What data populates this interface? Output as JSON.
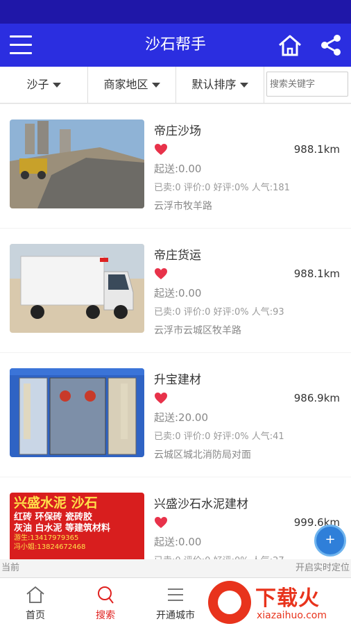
{
  "header": {
    "title": "沙石帮手"
  },
  "filters": {
    "category": "沙子",
    "region": "商家地区",
    "sort": "默认排序",
    "search_placeholder": "搜索关键字"
  },
  "items": [
    {
      "name": "帝庄沙场",
      "distance": "988.1km",
      "delivery": "起送:0.00",
      "stats": "已卖:0 评价:0 好评:0% 人气:181",
      "address": "云浮市牧羊路"
    },
    {
      "name": "帝庄货运",
      "distance": "988.1km",
      "delivery": "起送:0.00",
      "stats": "已卖:0 评价:0 好评:0% 人气:93",
      "address": "云浮市云城区牧羊路"
    },
    {
      "name": "升宝建材",
      "distance": "986.9km",
      "delivery": "起送:20.00",
      "stats": "已卖:0 评价:0 好评:0% 人气:41",
      "address": "云城区城北消防局对面"
    },
    {
      "name": "兴盛沙石水泥建材",
      "distance": "999.6km",
      "delivery": "起送:0.00",
      "stats": "已卖:0 评价:0 好评:0% 人气:27",
      "address": ""
    }
  ],
  "thumb4": {
    "line1": "兴盛水泥 沙石",
    "line2": "红砖  环保砖  瓷砖胶",
    "line3": "灰油 白水泥 等建筑材料",
    "line4": "游生:13417979365",
    "line5": "冯小姐:13824672468"
  },
  "hint": {
    "left": "当前",
    "right": "开启实时定位"
  },
  "fab": {
    "label": "+"
  },
  "tabbar": {
    "home": "首页",
    "search": "搜索",
    "city": "开通城市"
  },
  "watermark": {
    "title": "下载火",
    "sub": "xiazaihuo.com"
  },
  "colors": {
    "header": "#2b2ee0",
    "statusbar": "#1f17a8",
    "active_tab": "#e0201e",
    "heart": "#e8324a"
  }
}
